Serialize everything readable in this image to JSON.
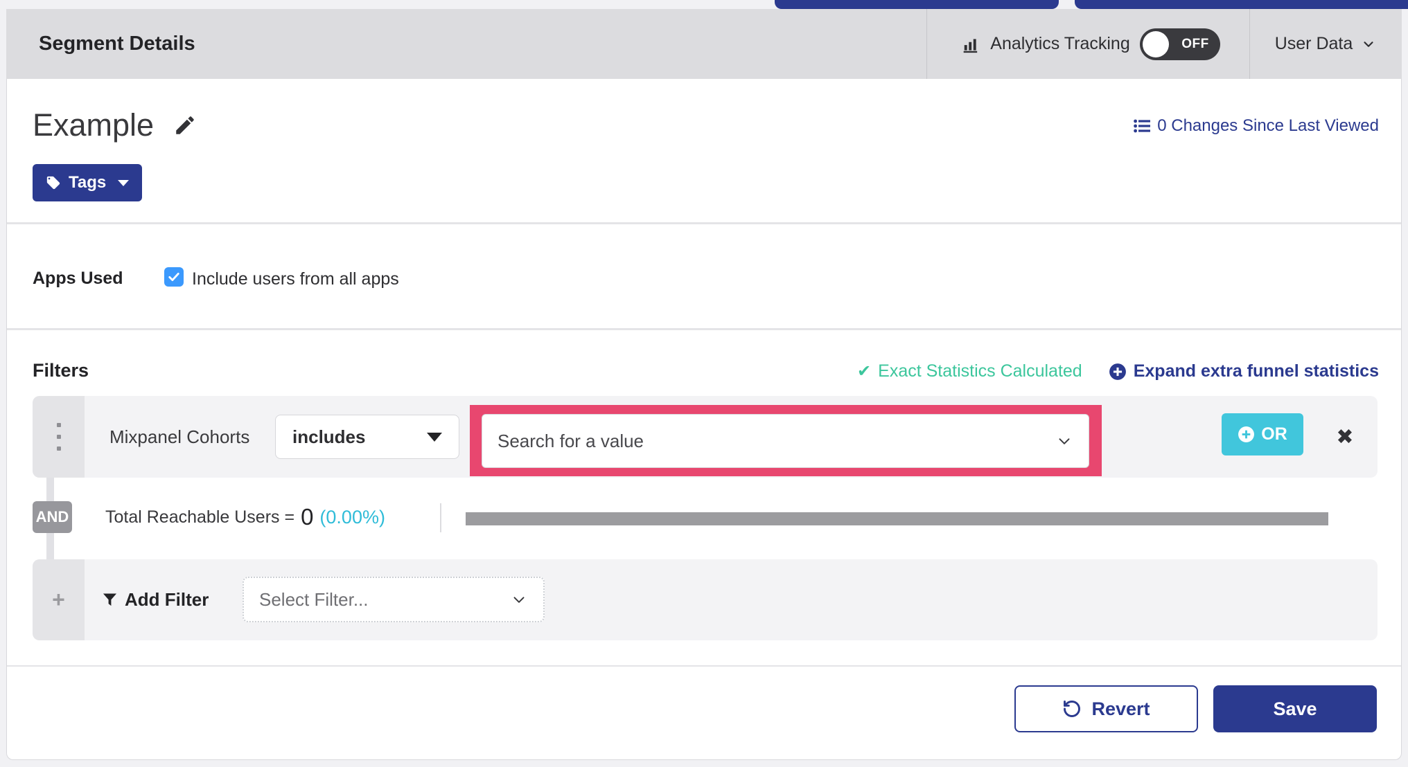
{
  "header": {
    "title": "Segment Details",
    "analytics_label": "Analytics Tracking",
    "toggle_state": "OFF",
    "user_data_label": "User Data"
  },
  "segment": {
    "name": "Example",
    "changes_link": "0 Changes Since Last Viewed",
    "tags_label": "Tags"
  },
  "apps_used": {
    "label": "Apps Used",
    "checkbox_label": "Include users from all apps",
    "checked": true
  },
  "filters": {
    "heading": "Filters",
    "exact_stats_label": "Exact Statistics Calculated",
    "expand_link_label": "Expand extra funnel statistics",
    "row": {
      "name": "Mixpanel Cohorts",
      "operator": "includes",
      "value_placeholder": "Search for a value",
      "or_label": "OR",
      "close_glyph": "✖"
    },
    "and_label": "AND",
    "total_label": "Total Reachable Users =",
    "total_value": "0",
    "total_percent": "(0.00%)",
    "add_filter_label": "Add Filter",
    "add_plus_glyph": "+",
    "select_filter_placeholder": "Select Filter...",
    "check_glyph": "✔"
  },
  "footer": {
    "revert_label": "Revert",
    "save_label": "Save"
  },
  "colors": {
    "brand_indigo": "#2b3a8f",
    "cyan_accent": "#41c6dc",
    "teal_success": "#3cc69c",
    "pink_highlight": "#e8476f",
    "checkbox_blue": "#3b99fd",
    "header_gray": "#dcdcdf",
    "row_gray": "#f3f3f5",
    "bar_gray": "#9c9c9f"
  }
}
